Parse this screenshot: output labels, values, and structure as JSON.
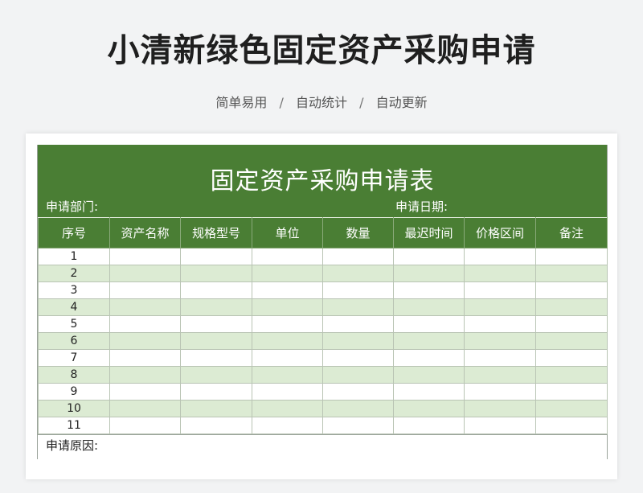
{
  "page": {
    "title": "小清新绿色固定资产采购申请",
    "subtitle": [
      "简单易用",
      "自动统计",
      "自动更新"
    ],
    "separator": "/"
  },
  "sheet": {
    "title": "固定资产采购申请表",
    "dept_label": "申请部门:",
    "date_label": "申请日期:",
    "columns": [
      "序号",
      "资产名称",
      "规格型号",
      "单位",
      "数量",
      "最迟时间",
      "价格区间",
      "备注"
    ],
    "rows": [
      "1",
      "2",
      "3",
      "4",
      "5",
      "6",
      "7",
      "8",
      "9",
      "10",
      "11"
    ],
    "reason_label": "申请原因:"
  },
  "colors": {
    "header_green": "#4a7e34",
    "stripe_green": "#dcebd3"
  }
}
